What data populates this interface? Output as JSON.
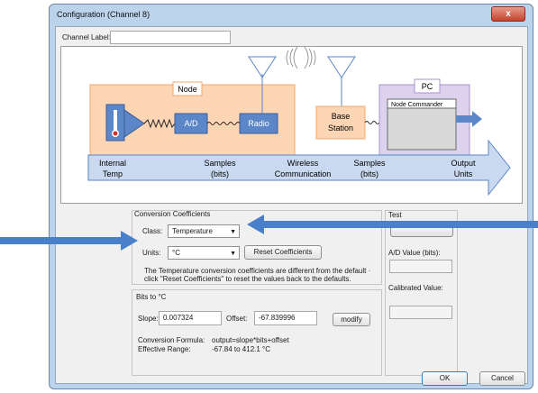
{
  "window": {
    "title": "Configuration (Channel 8)",
    "close_glyph": "x"
  },
  "channel_label": {
    "label": "Channel Label:",
    "value": ""
  },
  "diagram": {
    "node_title": "Node",
    "pc_title": "PC",
    "ad_label": "A/D",
    "radio_label": "Radio",
    "base_station_line1": "Base",
    "base_station_line2": "Station",
    "node_commander_label": "Node Commander",
    "stages": [
      {
        "line1": "Internal",
        "line2": "Temp"
      },
      {
        "line1": "Samples",
        "line2": "(bits)"
      },
      {
        "line1": "Wireless",
        "line2": "Communication"
      },
      {
        "line1": "Samples",
        "line2": "(bits)"
      },
      {
        "line1": "Output",
        "line2": "Units"
      }
    ],
    "colors": {
      "node_fill": "#fcd5b4",
      "pc_fill": "#ddd2ee",
      "box_blue": "#5b86c7",
      "flow_arrow": "#c9daf0"
    }
  },
  "conversion": {
    "group_title": "Conversion Coefficients",
    "class_label": "Class:",
    "class_value": "Temperature",
    "units_label": "Units:",
    "units_value": "°C",
    "reset_button": "Reset Coefficients",
    "info_line1": "The Temperature conversion coefficients are different from the default ·",
    "info_line2": "click \"Reset Coefficients\" to reset the values back to the defaults."
  },
  "bits": {
    "group_title": "Bits to °C",
    "slope_label": "Slope:",
    "slope_value": "0.007324",
    "offset_label": "Offset:",
    "offset_value": "-67.839996",
    "modify_button": "modify",
    "formula_label": "Conversion Formula:",
    "formula_value": "output=slope*bits+offset",
    "range_label": "Effective Range:",
    "range_value": "-67.84 to 412.1 °C"
  },
  "test": {
    "group_title": "Test",
    "ad_label": "A/D Value (bits):",
    "cal_label": "Calibrated Value:"
  },
  "buttons": {
    "ok": "OK",
    "cancel": "Cancel"
  },
  "annotation_arrow_color": "#4a7fc9"
}
